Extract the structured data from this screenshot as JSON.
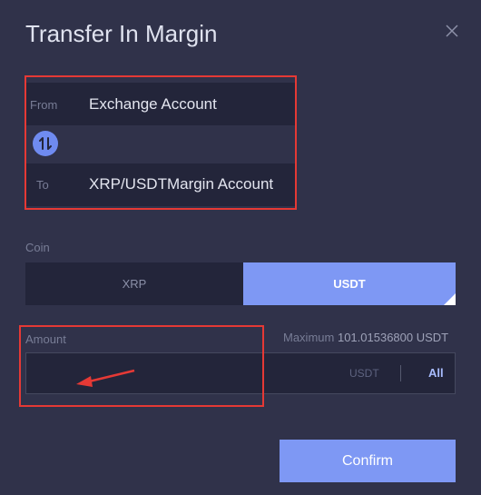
{
  "dialog": {
    "title": "Transfer In Margin"
  },
  "transfer": {
    "from_label": "From",
    "from_value": "Exchange Account",
    "to_label": "To",
    "to_value": "XRP/USDTMargin Account"
  },
  "coin": {
    "label": "Coin",
    "options": [
      "XRP",
      "USDT"
    ],
    "selected": "USDT"
  },
  "amount": {
    "label": "Amount",
    "maximum_label": "Maximum",
    "maximum_value": "101.01536800 USDT",
    "unit": "USDT",
    "all_label": "All"
  },
  "confirm_label": "Confirm",
  "colors": {
    "background": "#30324a",
    "field": "#23253a",
    "accent": "#7e98f4",
    "annotation": "#e53935"
  }
}
